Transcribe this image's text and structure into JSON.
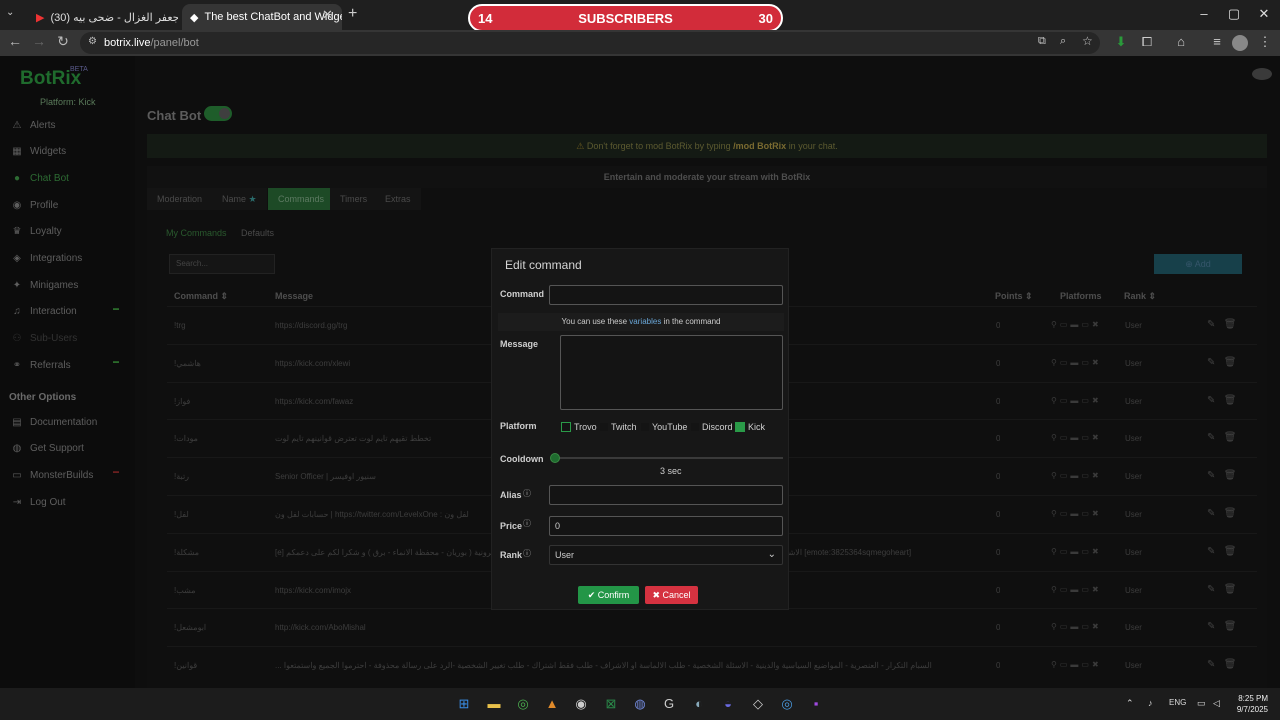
{
  "browser": {
    "tabs": [
      {
        "title": "جعفر الغزال - ضحى بيه (30)",
        "active": false
      },
      {
        "title": "The best ChatBot and Widgets",
        "active": true
      }
    ],
    "url_host": "botrix.live",
    "url_path": "/panel/bot"
  },
  "overlay": {
    "left": "14",
    "center": "SUBSCRIBERS",
    "right": "30"
  },
  "sidebar": {
    "logo": "BotRix",
    "beta": "BETA",
    "platform_label": "Platform:",
    "platform_value": "Kick",
    "items": [
      {
        "label": "Alerts"
      },
      {
        "label": "Widgets"
      },
      {
        "label": "Chat Bot"
      },
      {
        "label": "Profile"
      },
      {
        "label": "Loyalty"
      },
      {
        "label": "Integrations"
      },
      {
        "label": "Minigames"
      },
      {
        "label": "Interaction"
      },
      {
        "label": "Sub-Users"
      },
      {
        "label": "Referrals"
      }
    ],
    "other_title": "Other Options",
    "other_items": [
      {
        "label": "Documentation"
      },
      {
        "label": "Get Support"
      },
      {
        "label": "MonsterBuilds"
      },
      {
        "label": "Log Out"
      }
    ]
  },
  "main": {
    "title": "Chat Bot",
    "notice_pre": "Don't forget to mod BotRix by typing",
    "notice_cmd": "/mod BotRix",
    "notice_post": "in your chat.",
    "entertain": "Entertain and moderate your stream with BotRix",
    "tabs": [
      "Moderation",
      "Name",
      "Commands",
      "Timers",
      "Extras"
    ],
    "subtabs": [
      "My Commands",
      "Defaults"
    ],
    "search_placeholder": "Search...",
    "add_label": "Add",
    "headers": {
      "command": "Command",
      "message": "Message",
      "points": "Points",
      "platforms": "Platforms",
      "rank": "Rank"
    },
    "rows": [
      {
        "command": "!trg",
        "message": "https://discord.gg/trg",
        "points": "0",
        "rank": "User"
      },
      {
        "command": "!هاشمي",
        "message": "https://kick.com/xlewi",
        "points": "0",
        "rank": "User"
      },
      {
        "command": "!فواز",
        "message": "https://kick.com/fawaz",
        "points": "0",
        "rank": "User"
      },
      {
        "command": "!مودات",
        "message": "تخطط تقيهم تايم لوت تعترض قوانينهم تايم لوت",
        "points": "0",
        "rank": "User"
      },
      {
        "command": "!رتبة",
        "message": "Senior Officer | سنيور اوفيسر",
        "points": "0",
        "rank": "User"
      },
      {
        "command": "!لفل",
        "message": "حسابات لفل ون | https://twitter.com/LevelxOne : لفل ون",
        "points": "0",
        "rank": "User"
      },
      {
        "command": "!مشكلة",
        "message": "[e] الاشتراك معلق المشكله في بنك الراجحي او البنك المستخدم، الافضل تغير و تستخدم بطاقة الكترونية ( بوريان - محفظة الانماء - برق ) و شكرا لكم على دعمكم [emote:3825364sqmegoheart]",
        "points": "0",
        "rank": "User"
      },
      {
        "command": "!مشب",
        "message": "https://kick.com/imojx",
        "points": "0",
        "rank": "User"
      },
      {
        "command": "!ابومشعل",
        "message": "http://kick.com/AboMishal",
        "points": "0",
        "rank": "User"
      },
      {
        "command": "!قوانين",
        "message": "... السبام التكرار - العنصرية - المواضيع السياسية والدينية - الاسئلة الشخصية - طلب الالماسة او الاشراف - طلب فقط اشتراك - طلب تغيير الشخصية -الرد على رسالة محذوفة - احترموا الجميع واستمتعوا",
        "points": "0",
        "rank": "User"
      }
    ]
  },
  "modal": {
    "title": "Edit command",
    "command_label": "Command",
    "command_value": "",
    "hint_pre": "You can use these",
    "hint_link": "variables",
    "hint_post": "in the command",
    "message_label": "Message",
    "platform_label": "Platform",
    "platforms": [
      {
        "name": "Trovo",
        "checked": false
      },
      {
        "name": "Twitch",
        "checked": false
      },
      {
        "name": "YouTube",
        "checked": false
      },
      {
        "name": "Discord",
        "checked": false
      },
      {
        "name": "Kick",
        "checked": true
      }
    ],
    "cooldown_label": "Cooldown",
    "cooldown_value": "3 sec",
    "alias_label": "Alias",
    "alias_value": "",
    "price_label": "Price",
    "price_value": "0",
    "rank_label": "Rank",
    "rank_value": "User",
    "confirm_label": "Confirm",
    "cancel_label": "Cancel"
  },
  "taskbar": {
    "lang": "ENG",
    "time": "8:25 PM",
    "date": "9/7/2025"
  },
  "colors": {
    "accent": "#239647",
    "danger": "#d53240",
    "overlay": "#d22c3a"
  }
}
